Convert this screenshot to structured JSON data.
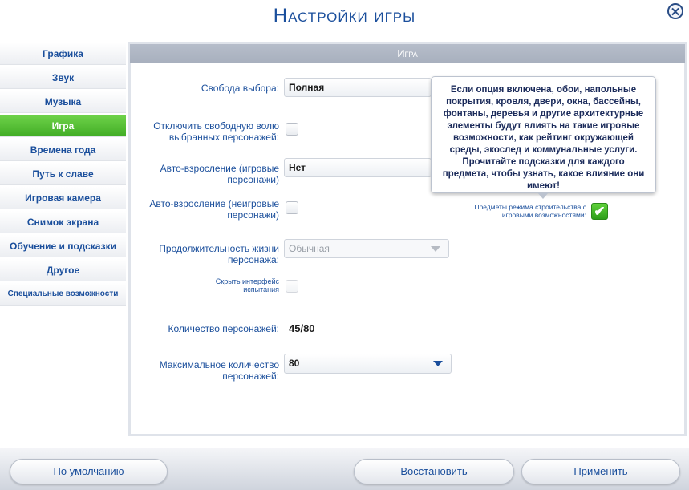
{
  "window": {
    "title": "Настройки игры",
    "close_label": "✕"
  },
  "sidebar": {
    "items": [
      {
        "label": "Графика"
      },
      {
        "label": "Звук"
      },
      {
        "label": "Музыка"
      },
      {
        "label": "Игра",
        "active": true
      },
      {
        "label": "Времена года"
      },
      {
        "label": "Путь к славе"
      },
      {
        "label": "Игровая камера"
      },
      {
        "label": "Снимок экрана"
      },
      {
        "label": "Обучение и подсказки"
      },
      {
        "label": "Другое"
      },
      {
        "label": "Специальные возможности"
      }
    ]
  },
  "panel": {
    "header": "Игра",
    "free_will": {
      "label": "Свобода выбора:",
      "value": "Полная"
    },
    "disable_free_will": {
      "label": "Отключить свободную волю выбранных персонажей:",
      "checked": false
    },
    "auto_aging_played": {
      "label": "Авто-взросление (игровые персонажи)",
      "value": "Нет"
    },
    "auto_aging_unplayed": {
      "label": "Авто-взросление (неигровые персонажи)",
      "checked": false
    },
    "lifespan": {
      "label": "Продолжительность жизни персонажа:",
      "value": "Обычная"
    },
    "hide_trial_ui": {
      "label": "Скрыть интерфейс испытания",
      "checked": false
    },
    "sim_count": {
      "label": "Количество персонажей:",
      "value": "45/80"
    },
    "max_sims": {
      "label": "Максимальное количество персонажей:",
      "value": "80"
    },
    "build_mode": {
      "label": "Предметы режима строительства с игровыми возможностями:",
      "checked": true,
      "check_glyph": "✔"
    },
    "tooltip": "Если опция включена, обои, напольные покрытия, кровля, двери, окна, бассейны, фонтаны, деревья и другие архитектурные элементы будут влиять на такие игровые возможности, как рейтинг окружающей среды, экослед и коммунальные услуги. Прочитайте подсказки для каждого предмета, чтобы узнать, какое влияние они имеют!"
  },
  "footer": {
    "default_label": "По умолчанию",
    "restore_label": "Восстановить",
    "apply_label": "Применить"
  },
  "colors": {
    "accent": "#1b4f9c",
    "active_tab": "#4fba2f",
    "header_bar": "#aeb5c3"
  },
  "icons": {
    "close": "close-icon",
    "dropdown": "chevron-down-icon",
    "check": "checkmark-icon"
  }
}
